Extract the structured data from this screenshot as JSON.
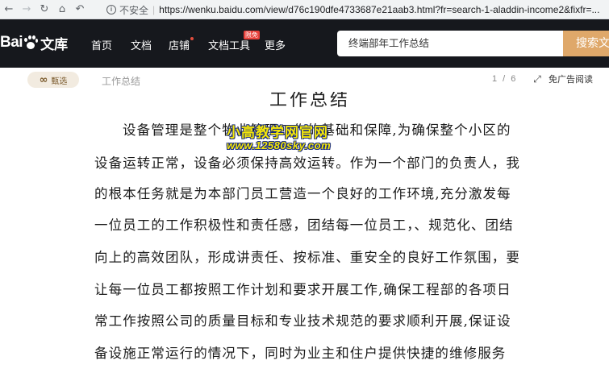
{
  "browser": {
    "security_label": "不安全",
    "url": "https://wenku.baidu.com/view/d76c190dfe4733687e21aab3.html?fr=search-1-aladdin-income2&fixfr=..."
  },
  "header": {
    "logo_bai": "Bai",
    "logo_du": "du",
    "logo_wenku": "文库",
    "nav": [
      {
        "label": "首页"
      },
      {
        "label": "文档"
      },
      {
        "label": "店铺"
      },
      {
        "label": "文档工具"
      },
      {
        "label": "更多"
      }
    ],
    "tool_badge": "限免",
    "search_value": "终端部年工作总结",
    "search_button": "搜索文"
  },
  "subbar": {
    "jingxuan_label": "甄选",
    "doc_name": "工作总结",
    "page_indicator": "1 / 6",
    "adfree_label": "免广告阅读"
  },
  "document": {
    "title": "工作总结",
    "lines": [
      "设备管理是整个物业管理工作的基础和保障,为确保整个小区的",
      "设备运转正常，设备必须保持高效运转。作为一个部门的负责人，我",
      "的根本任务就是为本部门员工营造一个良好的工作环境,充分激发每",
      "一位员工的工作积极性和责任感，团结每一位员工，、规范化、团结",
      "向上的高效团队，形成讲责任、按标准、重安全的良好工作氛围，要",
      "让每一位员工都按照工作计划和要求开展工作,确保工程部的各项日",
      "常工作按照公司的质量目标和专业技术规范的要求顺利开展,保证设",
      "备设施正常运行的情况下，同时为业主和住户提供快捷的维修服务"
    ]
  },
  "watermark": {
    "line1": "小高教学网官网",
    "line2": "www.12580sky.com"
  },
  "colors": {
    "header_bg": "#16181d",
    "search_button_bg": "#dfa86a",
    "jingxuan_bg": "#f2ebe0"
  }
}
